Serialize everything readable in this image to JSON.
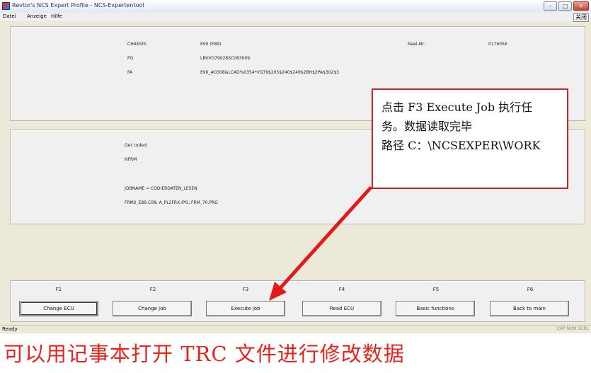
{
  "window": {
    "title": "Revtor's NCS Expert Profile - NCS-Expertentool",
    "minimize": "–",
    "maximize": "□",
    "close": "✕"
  },
  "menu": {
    "items": [
      "Datei",
      "Anzeige",
      "Hilfe"
    ],
    "close_tag": "关闭"
  },
  "info": {
    "chassis_label": "CHASSIS:",
    "chassis_value": "E90 (E89)",
    "fg_label": "FG",
    "fg_value": "LBVVG79028SC083009",
    "fa_label": "FA",
    "fa_value": "E90_#0308&LCAD%0354*VG79$205$240$249$2BH$2PA$302$3",
    "nael_label": "Nael-Nr.:",
    "nael_value": "017605¥"
  },
  "job": {
    "get_coded": "Get coded:",
    "module": "NFRM",
    "jobname": "JOBNAME = CODIERDATEN_LESEN",
    "files": "FRM2_E89.C08, A_PL2FRX.IPO, FRM_70.PRG"
  },
  "fkeys": [
    "F1",
    "F2",
    "F3",
    "F4",
    "F5",
    "F6"
  ],
  "buttons": [
    "Change ECU",
    "Change job",
    "Execute job",
    "Read ECU",
    "Basic functions",
    "Back to main"
  ],
  "status": {
    "left": "Ready",
    "right": "CAP  NUM  SCRL"
  },
  "annotation": {
    "line1": "点击 F3 Execute Job 执行任",
    "line2": "务。数据读取完毕",
    "line3": "路径 C：\\NCSEXPER\\WORK",
    "color": "#d42020"
  },
  "caption": "可以用记事本打开 TRC 文件进行修改数据"
}
